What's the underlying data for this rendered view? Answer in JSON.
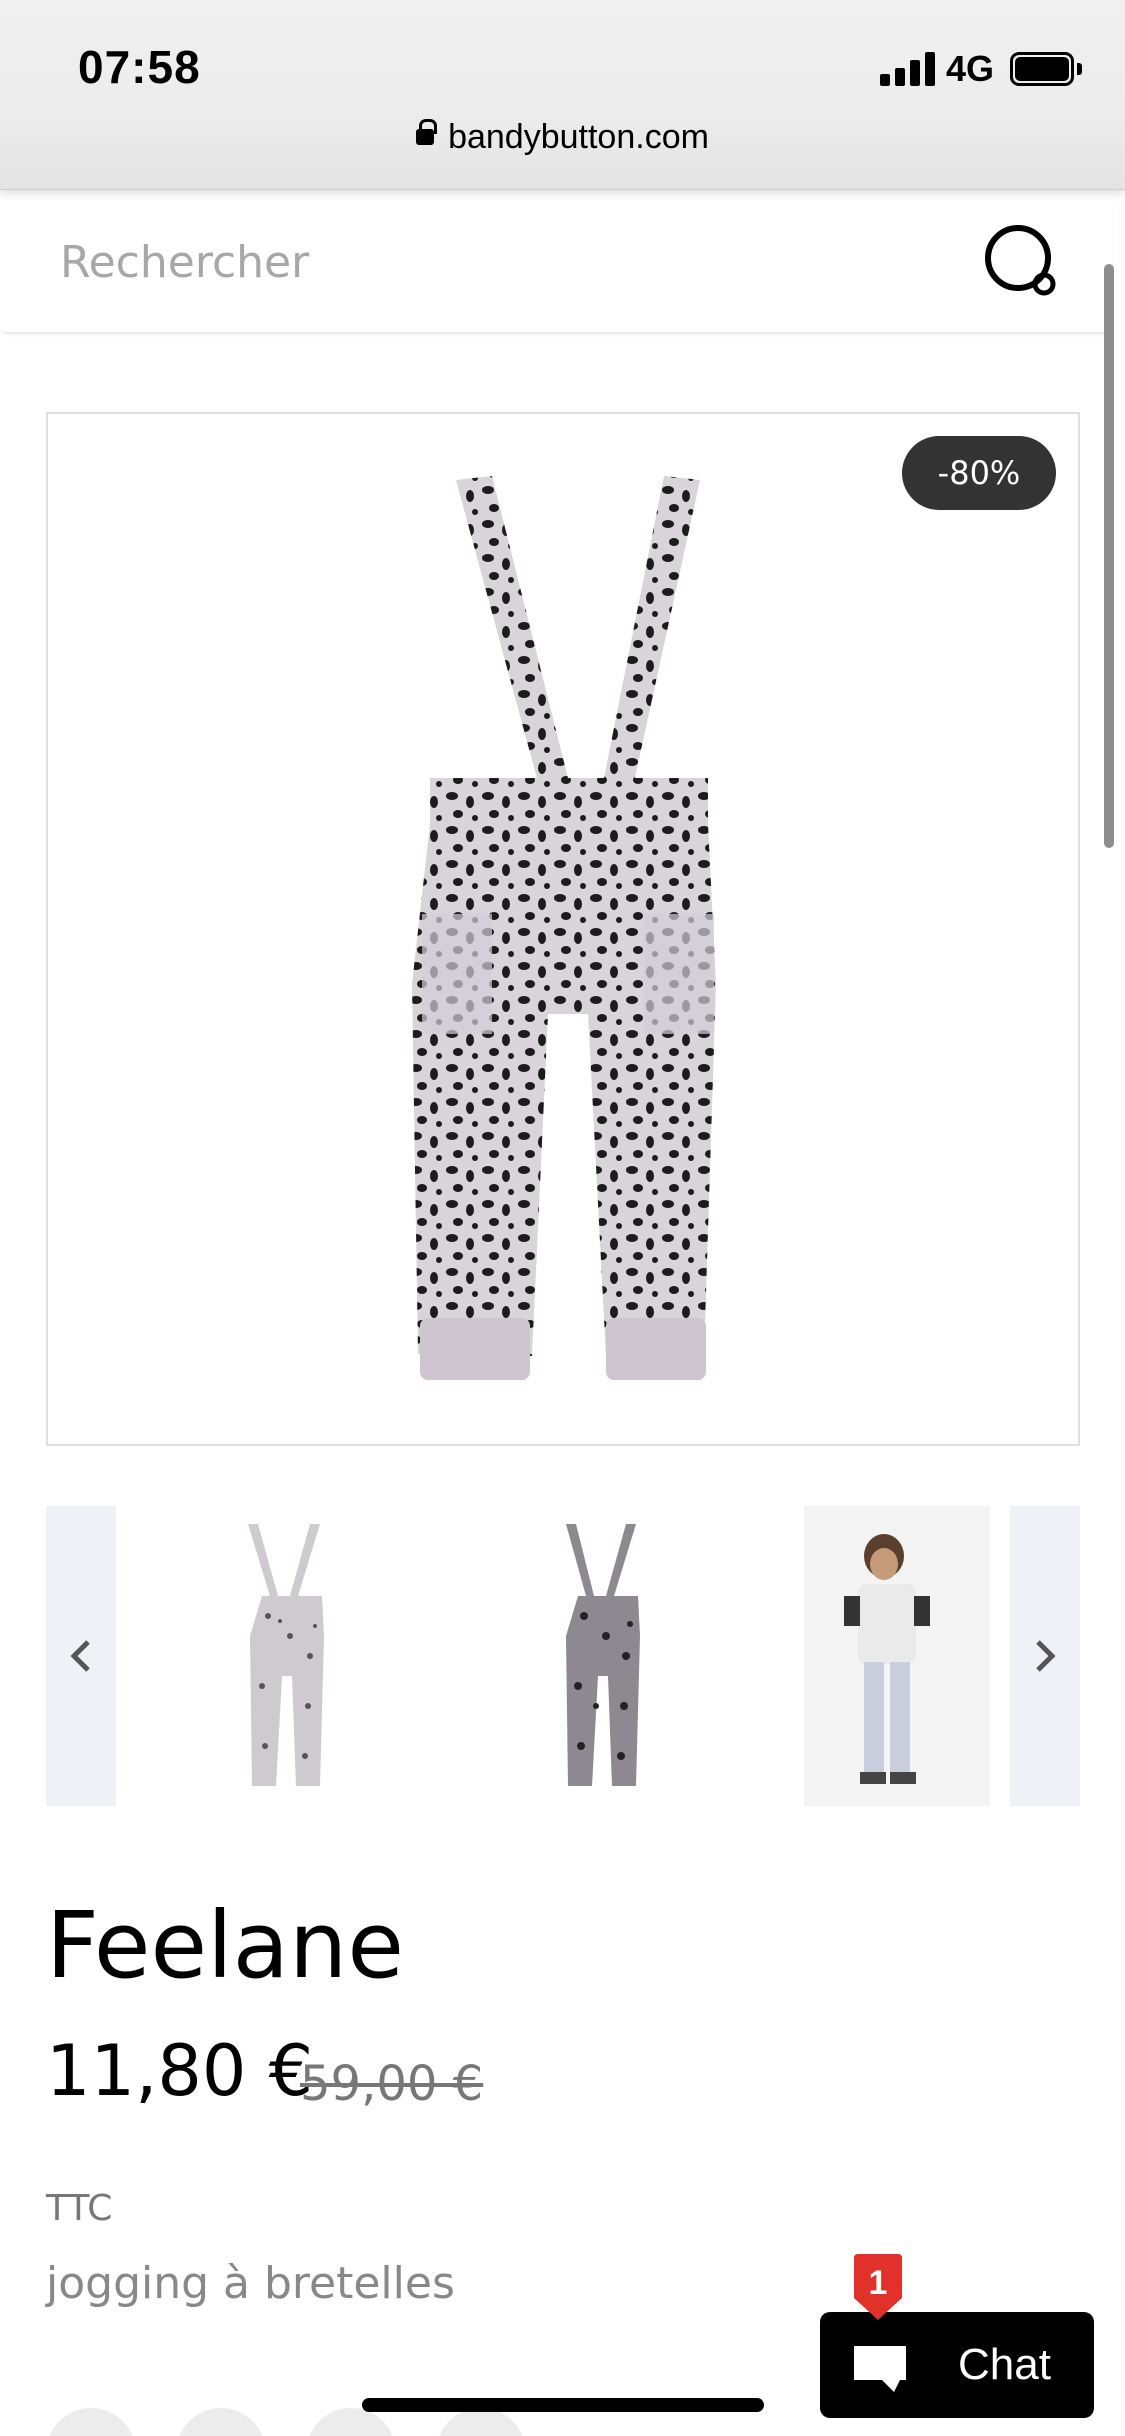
{
  "status_bar": {
    "time": "07:58",
    "network": "4G"
  },
  "browser": {
    "url": "bandybutton.com"
  },
  "search": {
    "placeholder": "Rechercher"
  },
  "product": {
    "discount_badge": "-80%",
    "title": "Feelane",
    "price": "11,80 €",
    "old_price": "59,00 €",
    "tax_label": "TTC",
    "short_description": "jogging à bretelles"
  },
  "chat": {
    "label": "Chat",
    "badge_count": "1"
  },
  "colors": {
    "accent": "#333333",
    "badge_red": "#e0312b",
    "chat_bg": "#000000"
  }
}
